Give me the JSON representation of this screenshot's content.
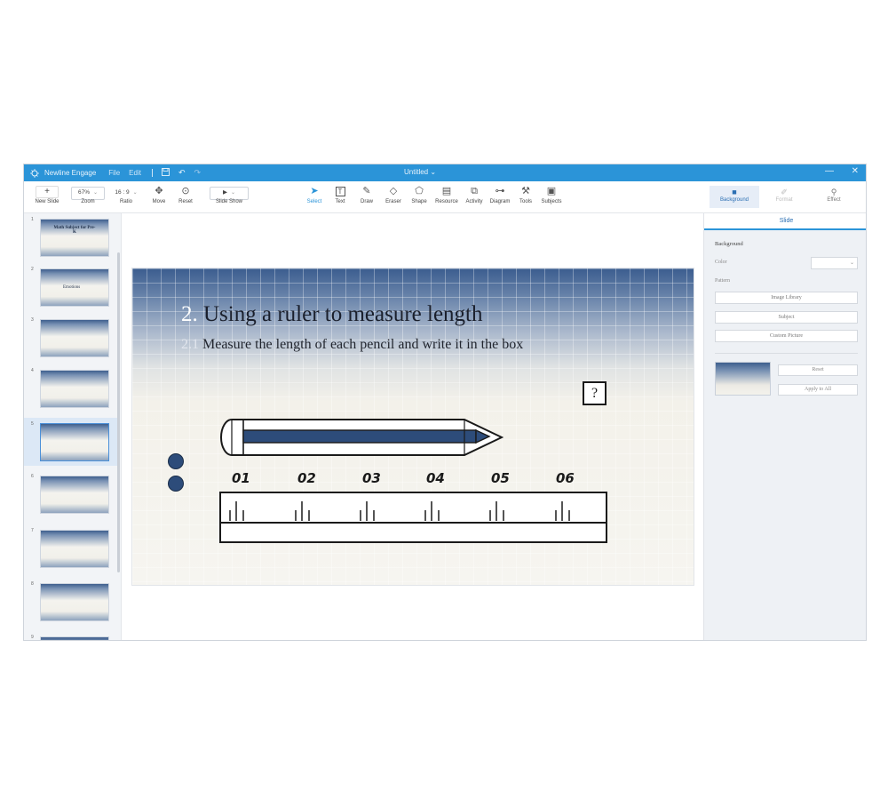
{
  "titlebar": {
    "app_name": "Newline Engage",
    "menu_file": "File",
    "menu_edit": "Edit",
    "doc_title": "Untitled",
    "title_chevron": "⌄"
  },
  "toolbar": {
    "new_slide": "New Slide",
    "zoom_value": "67%",
    "zoom_label": "Zoom",
    "ratio_value": "16 : 9",
    "ratio_label": "Ratio",
    "move_label": "Move",
    "reset_label": "Reset",
    "slideshow_label": "Slide Show",
    "tools": [
      {
        "label": "Select",
        "icon": "cursor-icon",
        "active": true
      },
      {
        "label": "Text",
        "icon": "text-icon"
      },
      {
        "label": "Draw",
        "icon": "pen-icon"
      },
      {
        "label": "Eraser",
        "icon": "eraser-icon"
      },
      {
        "label": "Shape",
        "icon": "shape-icon"
      },
      {
        "label": "Resource",
        "icon": "resource-icon"
      },
      {
        "label": "Activity",
        "icon": "activity-icon"
      },
      {
        "label": "Diagram",
        "icon": "diagram-icon"
      },
      {
        "label": "Tools",
        "icon": "tools-icon"
      },
      {
        "label": "Subjects",
        "icon": "subjects-icon"
      }
    ],
    "right_tabs": [
      {
        "label": "Background",
        "active": true
      },
      {
        "label": "Format"
      },
      {
        "label": "Effect"
      }
    ]
  },
  "thumbnails": [
    {
      "num": "1",
      "title": "Math Subject for Pre-K"
    },
    {
      "num": "2",
      "title": "Emotions"
    },
    {
      "num": "3",
      "title": ""
    },
    {
      "num": "4",
      "title": ""
    },
    {
      "num": "5",
      "title": ""
    },
    {
      "num": "6",
      "title": ""
    },
    {
      "num": "7",
      "title": ""
    },
    {
      "num": "8",
      "title": ""
    },
    {
      "num": "9",
      "title": ""
    }
  ],
  "slide": {
    "title_num": "2.",
    "title_text": "Using a ruler to measure length",
    "sub_num": "2.1",
    "sub_text": "Measure the length of each pencil and write it in the box",
    "answer": "?",
    "ruler_labels": [
      "01",
      "02",
      "03",
      "04",
      "05",
      "06"
    ]
  },
  "right_panel": {
    "tab": "Slide",
    "background_heading": "Background",
    "color_label": "Color",
    "pattern_label": "Pattern",
    "image_library": "Image Library",
    "subject": "Subject",
    "custom_picture": "Custom Picture",
    "reset": "Reset",
    "apply_all": "Apply to All"
  }
}
